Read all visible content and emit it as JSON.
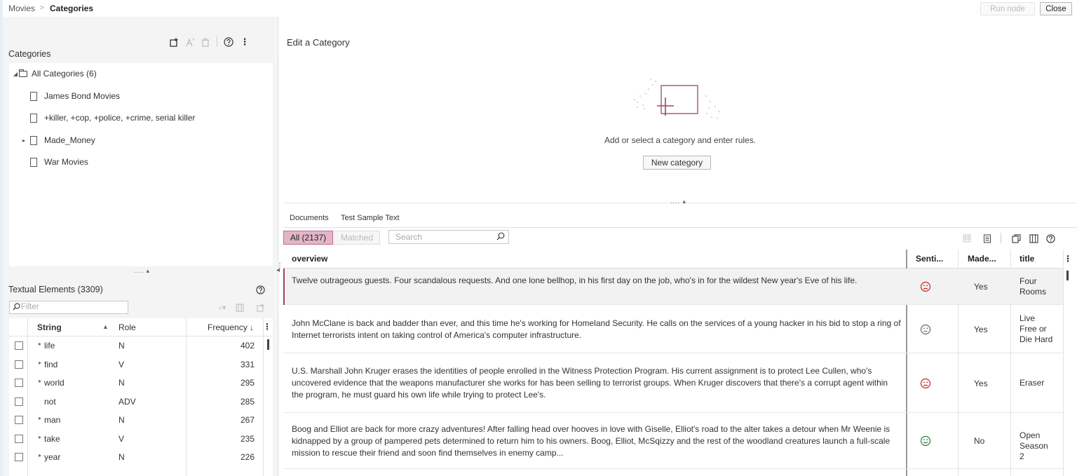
{
  "breadcrumb": {
    "root": "Movies",
    "separator": ">",
    "current": "Categories"
  },
  "topbar": {
    "run_node": "Run node",
    "close": "Close"
  },
  "categories_panel": {
    "title": "Categories",
    "tree": [
      {
        "label": "All Categories (6)",
        "type": "folder",
        "expanded": true
      },
      {
        "label": "James Bond Movies",
        "type": "doc"
      },
      {
        "label": "+killer, +cop, +police, +crime, serial killer",
        "type": "doc"
      },
      {
        "label": "Made_Money",
        "type": "doc",
        "collapsed": true
      },
      {
        "label": "War Movies",
        "type": "doc"
      }
    ]
  },
  "splitter": "....",
  "textual_elements": {
    "title": "Textual Elements (3309)",
    "filter_placeholder": "Filter",
    "columns": [
      "String",
      "Role",
      "Frequency ↓"
    ],
    "rows": [
      {
        "string": "life",
        "role": "N",
        "freq": "402",
        "expandable": true
      },
      {
        "string": "find",
        "role": "V",
        "freq": "331",
        "expandable": true
      },
      {
        "string": "world",
        "role": "N",
        "freq": "295",
        "expandable": true
      },
      {
        "string": "not",
        "role": "ADV",
        "freq": "285",
        "expandable": false
      },
      {
        "string": "man",
        "role": "N",
        "freq": "267",
        "expandable": true
      },
      {
        "string": "take",
        "role": "V",
        "freq": "235",
        "expandable": true
      },
      {
        "string": "year",
        "role": "N",
        "freq": "226",
        "expandable": true
      }
    ]
  },
  "edit_panel": {
    "title": "Edit a Category",
    "empty_message": "Add or select a category and enter rules.",
    "new_category": "New category"
  },
  "documents": {
    "tabs": [
      "Documents",
      "Test Sample Text"
    ],
    "filter_all": "All (2137)",
    "filter_matched": "Matched",
    "search_placeholder": "Search",
    "columns": [
      "overview",
      "Senti...",
      "Made...",
      "title"
    ],
    "rows": [
      {
        "overview": "Twelve outrageous guests. Four scandalous requests. And one lone bellhop, in his first day on the job, who's in for the wildest New year's Eve of his life.",
        "sentiment": "negative",
        "made": "Yes",
        "title": "Four Rooms"
      },
      {
        "overview": "John McClane is back and badder than ever, and this time he's working for Homeland Security. He calls on the services of a young hacker in his bid to stop a ring of Internet terrorists intent on taking control of America's computer infrastructure.",
        "sentiment": "neutral",
        "made": "Yes",
        "title": "Live Free or Die Hard"
      },
      {
        "overview": "U.S. Marshall John Kruger erases the identities of people enrolled in the Witness Protection Program. His current assignment is to protect Lee Cullen, who's uncovered evidence that the weapons manufacturer she works for has been selling to terrorist groups. When Kruger discovers that there's a corrupt agent within the program, he must guard his own life while trying to protect Lee's.",
        "sentiment": "negative",
        "made": "Yes",
        "title": "Eraser"
      },
      {
        "overview": "Boog and Elliot are back for more crazy adventures! After falling head over hooves in love with Giselle, Elliot's road to the alter takes a detour when Mr Weenie is kidnapped by a group of pampered pets determined to return him to his owners. Boog, Elliot, McSqizzy and the rest of the woodland creatures launch a full-scale mission to rescue their friend and soon find themselves in enemy camp...",
        "sentiment": "positive",
        "made": "No",
        "title": "Open Season 2"
      }
    ]
  },
  "colors": {
    "accent": "#a0426e",
    "accent_fill": "#e1b6c7",
    "negative": "#c62828",
    "positive": "#2e7d32",
    "neutral": "#666666"
  }
}
